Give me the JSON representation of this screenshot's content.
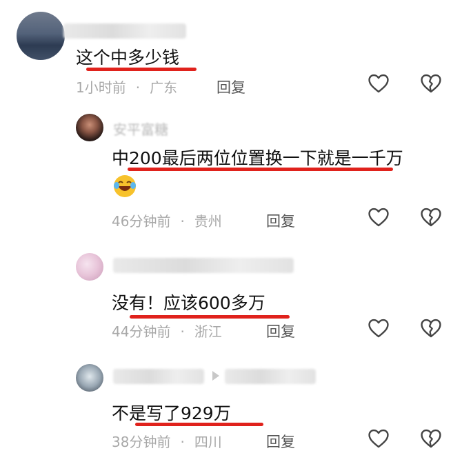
{
  "comments": [
    {
      "text": "这个中多少钱",
      "time": "1小时前",
      "location": "广东",
      "reply_label": "回复"
    },
    {
      "name": "安平富糖",
      "text": "中200最后两位位置换一下就是一千万",
      "emoji": "laughing-tears",
      "time": "46分钟前",
      "location": "贵州",
      "reply_label": "回复"
    },
    {
      "text": "没有！应该600多万",
      "time": "44分钟前",
      "location": "浙江",
      "reply_label": "回复"
    },
    {
      "text": "不是写了929万",
      "time": "38分钟前",
      "location": "四川",
      "reply_label": "回复"
    }
  ],
  "colors": {
    "underline": "#e0221c",
    "meta": "#a8a8a8",
    "icon": "#444444"
  },
  "icons": [
    "heart-icon",
    "broken-heart-icon"
  ]
}
